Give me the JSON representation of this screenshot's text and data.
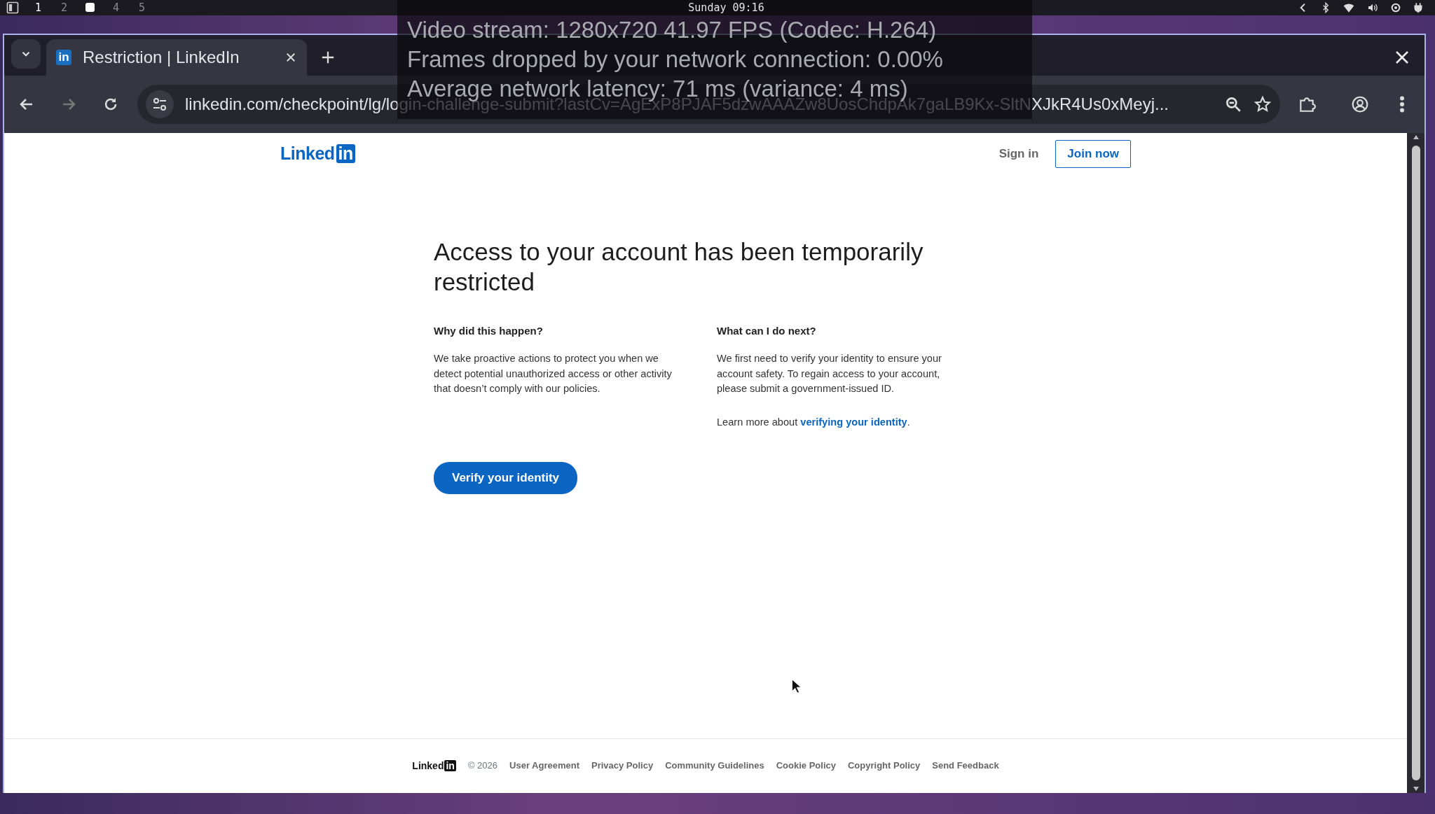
{
  "os_bar": {
    "workspaces": [
      {
        "kind": "number",
        "label": "1",
        "selected": true
      },
      {
        "kind": "number",
        "label": "2",
        "selected": false
      },
      {
        "kind": "square",
        "selected": true
      },
      {
        "kind": "number",
        "label": "4",
        "selected": false
      },
      {
        "kind": "number",
        "label": "5",
        "selected": false
      }
    ],
    "clock": "Sunday 09:16"
  },
  "stream_stats": [
    "Video stream: 1280x720 41.97 FPS (Codec: H.264)",
    "Frames dropped by your network connection: 0.00%",
    "Average network latency: 71 ms (variance: 4 ms)"
  ],
  "browser": {
    "tabs": [
      {
        "favicon": "in",
        "title": "Restriction | LinkedIn",
        "selected": true
      }
    ],
    "url": "linkedin.com/checkpoint/lg/login-challenge-submit?lastCv=AgExP8PJAF5dzwAAAZw8UosChdpAk7gaLB9Kx-SltNXJkR4Us0xMeyj..."
  },
  "page": {
    "logo": {
      "word": "Linked",
      "badge": "in"
    },
    "sign_in": "Sign in",
    "join_now": "Join now",
    "heading": "Access to your account has been temporarily restricted",
    "sections": [
      {
        "title": "Why did this happen?",
        "paragraphs": [
          {
            "text": "We take proactive actions to protect you when we detect potential unauthorized access or other activity that doesn’t comply with our policies."
          }
        ]
      },
      {
        "title": "What can I do next?",
        "paragraphs": [
          {
            "text": "We first need to verify your identity to ensure your account safety. To regain access to your account, please submit a government-issued ID."
          },
          {
            "text": "Learn more about ",
            "link": "verifying your identity",
            "after": "."
          }
        ]
      }
    ],
    "verify_button": "Verify your identity",
    "footer": {
      "logo": {
        "word": "Linked",
        "badge": "in"
      },
      "copyright": "© 2026",
      "links": [
        "User Agreement",
        "Privacy Policy",
        "Community Guidelines",
        "Cookie Policy",
        "Copyright Policy",
        "Send Feedback"
      ]
    }
  }
}
